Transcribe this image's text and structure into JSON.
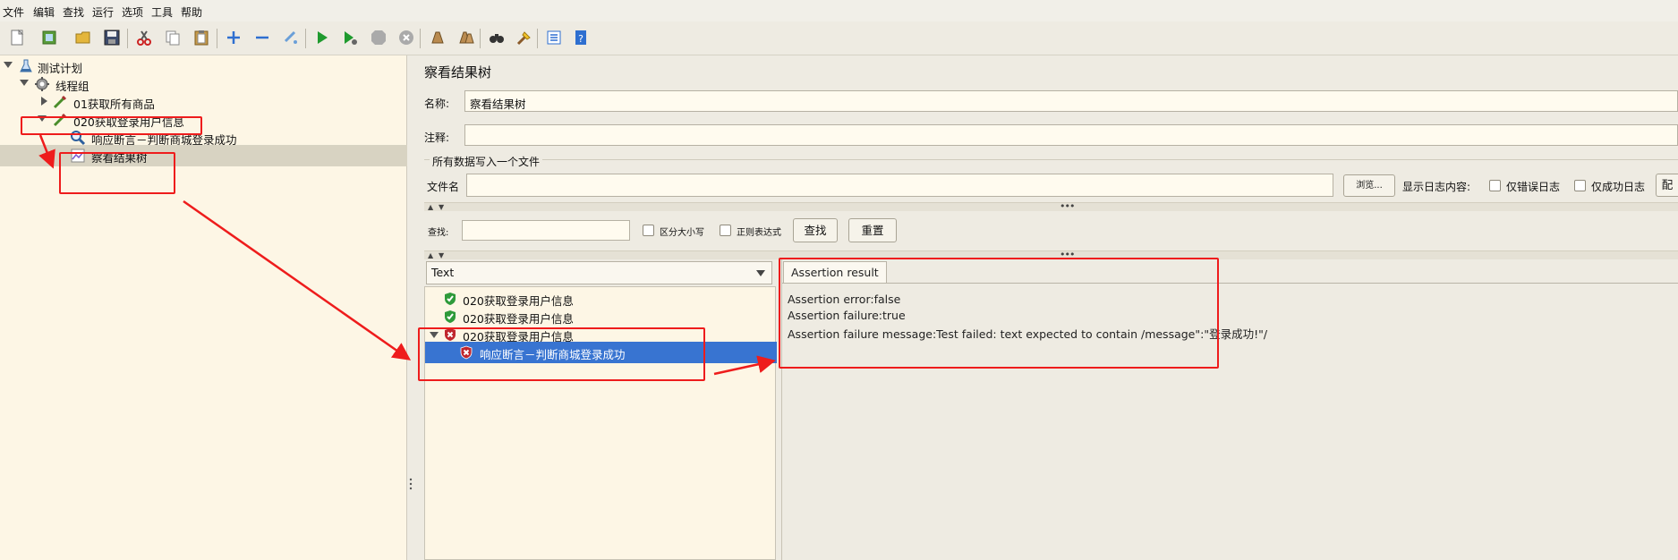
{
  "menu": [
    "文件",
    "编辑",
    "查找",
    "运行",
    "选项",
    "工具",
    "帮助"
  ],
  "toolbar": {
    "icons": [
      "new-icon",
      "templates-icon",
      "open-icon",
      "save-icon",
      "cut-icon",
      "copy-icon",
      "paste-icon",
      "expand-icon",
      "collapse-icon",
      "toggle-icon",
      "start-icon",
      "start-no-pauses-icon",
      "stop-icon",
      "shutdown-icon",
      "clear-icon",
      "clear-all-icon",
      "search-icon",
      "reset-search-icon",
      "function-helper-icon",
      "help-icon"
    ]
  },
  "tree": {
    "items": [
      {
        "label": "测试计划",
        "icon": "test-plan-icon",
        "expanded": true
      },
      {
        "label": "线程组",
        "icon": "thread-group-icon",
        "expanded": true
      },
      {
        "label": "01获取所有商品",
        "icon": "http-sampler-icon",
        "expanded": false
      },
      {
        "label": "020获取登录用户信息",
        "icon": "http-sampler-icon",
        "expanded": true
      },
      {
        "label": "响应断言－判断商城登录成功",
        "icon": "assertion-icon"
      },
      {
        "label": "察看结果树",
        "icon": "listener-icon",
        "selected": true
      }
    ]
  },
  "panel": {
    "title": "察看结果树",
    "name_label": "名称:",
    "name_value": "察看结果树",
    "comment_label": "注释:",
    "comment_value": "",
    "file_section_title": "所有数据写入一个文件",
    "filename_label": "文件名",
    "filename_value": "",
    "browse_button": "浏览...",
    "log_content_label": "显示日志内容:",
    "errors_only_label": "仅错误日志",
    "success_only_label": "仅成功日志",
    "configure_button": "配"
  },
  "search": {
    "label": "查找:",
    "value": "",
    "case_sensitive_label": "区分大小写",
    "regex_label": "正则表达式",
    "find_button": "查找",
    "reset_button": "重置"
  },
  "renderer": {
    "selected": "Text"
  },
  "results": [
    {
      "label": "020获取登录用户信息",
      "status": "success"
    },
    {
      "label": "020获取登录用户信息",
      "status": "success"
    },
    {
      "label": "020获取登录用户信息",
      "status": "failure",
      "expanded": true
    },
    {
      "label": "响应断言－判断商城登录成功",
      "status": "failure",
      "child": true,
      "selected": true
    }
  ],
  "detail": {
    "tab_label": "Assertion result",
    "lines": [
      "Assertion error:false",
      "Assertion failure:true",
      "Assertion failure message:Test failed: text expected to contain /message\":\"登录成功!\"/"
    ]
  },
  "colors": {
    "annotation_red": "#ee1c1c",
    "selection_blue": "#3874d1",
    "tree_background": "#fdf6e5",
    "success_green": "#2e9a3a",
    "failure_red": "#c0272d"
  }
}
